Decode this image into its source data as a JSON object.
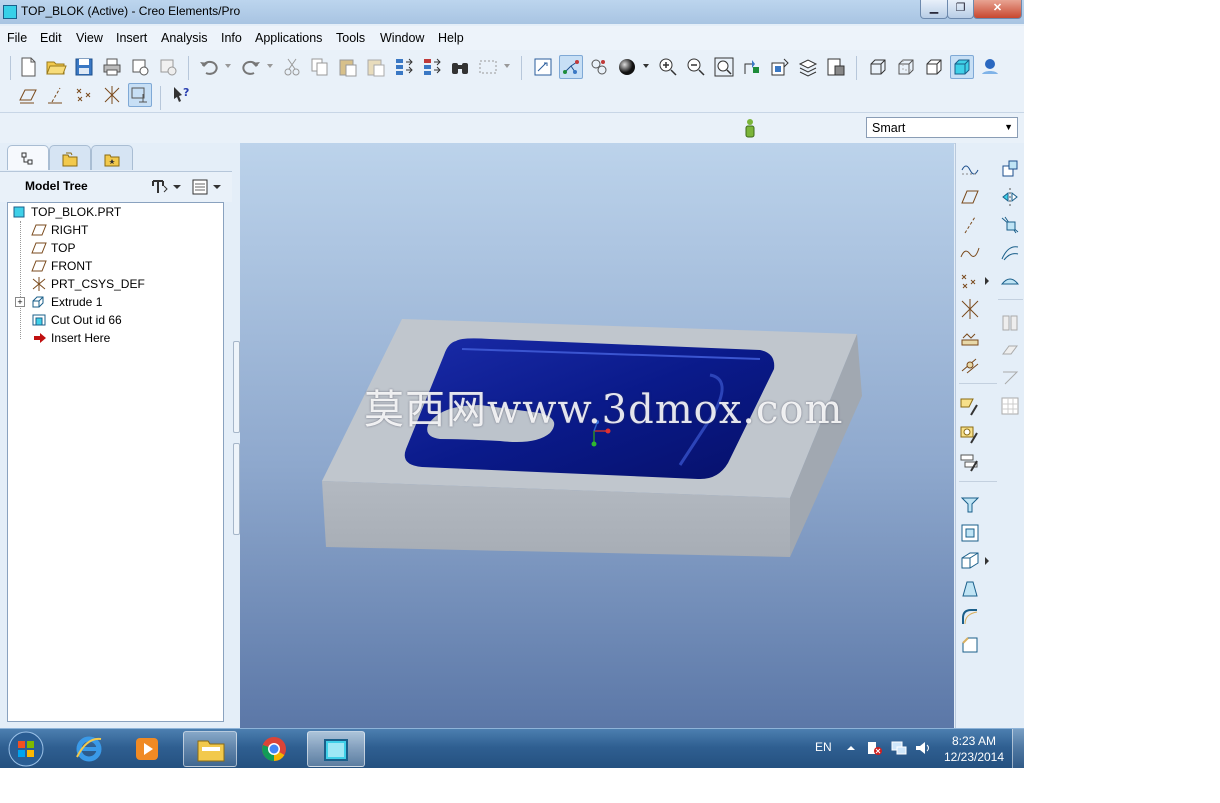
{
  "window": {
    "title": "TOP_BLOK (Active) - Creo Elements/Pro",
    "minimize_glyph": "▁",
    "maximize_glyph": "❐",
    "close_glyph": "✕"
  },
  "menubar": [
    "File",
    "Edit",
    "View",
    "Insert",
    "Analysis",
    "Info",
    "Applications",
    "Tools",
    "Window",
    "Help"
  ],
  "filter": {
    "selected": "Smart"
  },
  "navigator": {
    "tabs": [
      "model-tree",
      "folder-browser",
      "favorites"
    ],
    "header": "Model Tree",
    "tree": [
      {
        "label": "TOP_BLOK.PRT",
        "icon": "part-icon"
      },
      {
        "label": "RIGHT",
        "icon": "datum-plane-icon"
      },
      {
        "label": "TOP",
        "icon": "datum-plane-icon"
      },
      {
        "label": "FRONT",
        "icon": "datum-plane-icon"
      },
      {
        "label": "PRT_CSYS_DEF",
        "icon": "csys-icon"
      },
      {
        "label": "Extrude 1",
        "icon": "extrude-icon"
      },
      {
        "label": "Cut Out id 66",
        "icon": "cut-icon"
      },
      {
        "label": "Insert Here",
        "icon": "insert-arrow-icon"
      }
    ]
  },
  "viewport": {
    "watermark": "莫西网www.3dmox.com"
  },
  "taskbar": {
    "language": "EN",
    "time": "8:23 AM",
    "date": "12/23/2014"
  },
  "colors": {
    "pocket": "#0b1d8c",
    "block": "#b9bfc6",
    "viewport_top": "#bcd3eb",
    "viewport_bottom": "#5b77a7"
  }
}
